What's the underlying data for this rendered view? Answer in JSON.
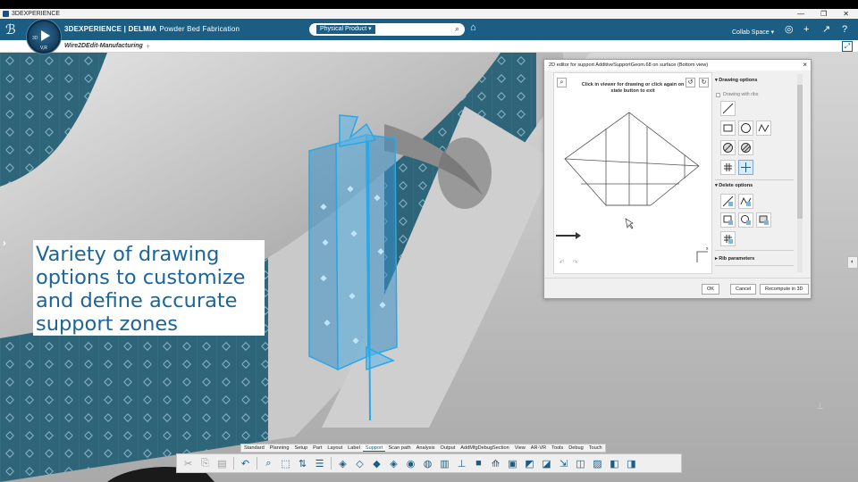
{
  "os_window": {
    "title": "3DEXPERIENCE",
    "controls": [
      "—",
      "❐",
      "✕"
    ]
  },
  "app_header": {
    "brand": "3DEXPERIENCE | DELMIA",
    "app_name": "Powder Bed Fabrication",
    "compass": {
      "label_left": "3D",
      "label_right": "V,R",
      "version": "V,R"
    },
    "search": {
      "source": "Physical Product ▾",
      "placeholder": ""
    },
    "collab_space": "Collab Space ▾",
    "icons": [
      "tag-icon",
      "user-icon",
      "add-icon",
      "share-icon",
      "help-icon"
    ]
  },
  "tab_strip": {
    "active_tab": "Wire2DEdit-Manufacturing",
    "add_tab": "+"
  },
  "caption": {
    "text": "Variety of drawing options to customize and define accurate support zones"
  },
  "dialog": {
    "title": "2D editor for support AdditiveSupportGeom.68 on surface (Bottom view)",
    "close": "×",
    "instruction": "Click in viewer for drawing or click again on state button to exit",
    "drawing_options": {
      "heading": "Drawing options",
      "checkbox_label": "Drawing with ribs",
      "checkbox_checked": false,
      "tools": [
        "line-tool-icon",
        "rectangle-tool-icon",
        "circle-tool-icon",
        "spline-tool-icon",
        "hatched-circle-icon",
        "hatched-circle-alt-icon",
        "rib-grid-icon",
        "point-cross-icon"
      ],
      "active_tool": "point-cross-icon"
    },
    "delete_options": {
      "heading": "Delete options",
      "tools": [
        "delete-line-icon",
        "delete-spline-icon",
        "delete-rect-icon",
        "delete-circle-icon",
        "delete-hatched-icon",
        "delete-grid-icon"
      ]
    },
    "rib_parameters": {
      "heading": "Rib parameters"
    },
    "footer": {
      "ok": "OK",
      "cancel": "Cancel",
      "recompute": "Recompute in 3D"
    }
  },
  "command_tabs": [
    "Standard",
    "Planning",
    "Setup",
    "Part",
    "Layout",
    "Label",
    "Support",
    "Scan path",
    "Analysis",
    "Output",
    "AddMfgDebugSection",
    "View",
    "AR-VR",
    "Tools",
    "Debug",
    "Touch"
  ],
  "active_command_tab": "Support",
  "command_icons": [
    "cut-icon",
    "copy-icon",
    "paste-icon",
    "undo-icon",
    "zoom-icon",
    "select-icon",
    "tree-icon",
    "list-icon",
    "support-icon-1",
    "support-icon-2",
    "support-icon-3",
    "support-icon-4",
    "support-icon-5",
    "support-icon-6",
    "support-icon-7",
    "support-icon-8",
    "support-icon-9",
    "support-icon-10",
    "support-icon-11",
    "support-icon-12",
    "support-icon-13",
    "support-icon-14",
    "support-icon-15",
    "support-icon-16",
    "support-icon-17",
    "support-icon-18"
  ],
  "colors": {
    "header": "#1b5d83",
    "caption_text": "#1d6596",
    "support_blue": "#2aa7e6",
    "background_plate": "#2e6579"
  }
}
